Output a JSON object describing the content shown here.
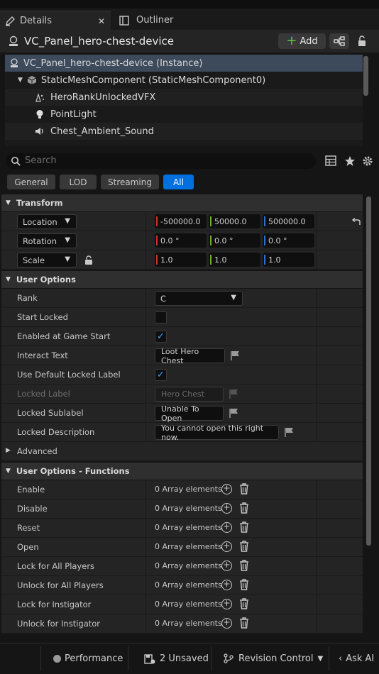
{
  "tabs": {
    "details": "Details",
    "outliner": "Outliner"
  },
  "header": {
    "title": "VC_Panel_hero-chest-device",
    "add_label": "Add"
  },
  "tree": {
    "items": [
      "VC_Panel_hero-chest-device (Instance)",
      "StaticMeshComponent (StaticMeshComponent0)",
      "HeroRankUnlockedVFX",
      "PointLight",
      "Chest_Ambient_Sound"
    ]
  },
  "search": {
    "placeholder": "Search"
  },
  "filters": [
    "General",
    "LOD",
    "Streaming",
    "All"
  ],
  "transform": {
    "section": "Transform",
    "location_label": "Location",
    "rotation_label": "Rotation",
    "scale_label": "Scale",
    "location": [
      "-500000.0",
      "50000.0",
      "500000.0"
    ],
    "rotation": [
      "0.0 °",
      "0.0 °",
      "0.0 °"
    ],
    "scale": [
      "1.0",
      "1.0",
      "1.0"
    ]
  },
  "user_options": {
    "section": "User Options",
    "rank_label": "Rank",
    "rank_value": "C",
    "start_locked_label": "Start Locked",
    "start_locked": false,
    "enabled_label": "Enabled at Game Start",
    "enabled": true,
    "interact_text_label": "Interact Text",
    "interact_text": "Loot Hero Chest",
    "use_default_label": "Use Default Locked Label",
    "use_default": true,
    "locked_label_label": "Locked Label",
    "locked_label": "Hero Chest",
    "locked_sublabel_label": "Locked Sublabel",
    "locked_sublabel": "Unable To Open",
    "locked_desc_label": "Locked Description",
    "locked_desc": "You cannot open this right now."
  },
  "advanced": {
    "section": "Advanced"
  },
  "functions": {
    "section": "User Options - Functions",
    "array_text": "0 Array elements",
    "items": [
      "Enable",
      "Disable",
      "Reset",
      "Open",
      "Lock for All Players",
      "Unlock for All Players",
      "Lock for Instigator",
      "Unlock for Instigator"
    ]
  },
  "status": {
    "performance": "Performance",
    "unsaved": "2 Unsaved",
    "revision": "Revision Control",
    "ask_ai": "Ask AI"
  },
  "colors": {
    "accent": "#0070e0",
    "x_axis": "#c8342c",
    "y_axis": "#6ab02c",
    "z_axis": "#2c70d8",
    "add_icon": "#5ac83c"
  }
}
